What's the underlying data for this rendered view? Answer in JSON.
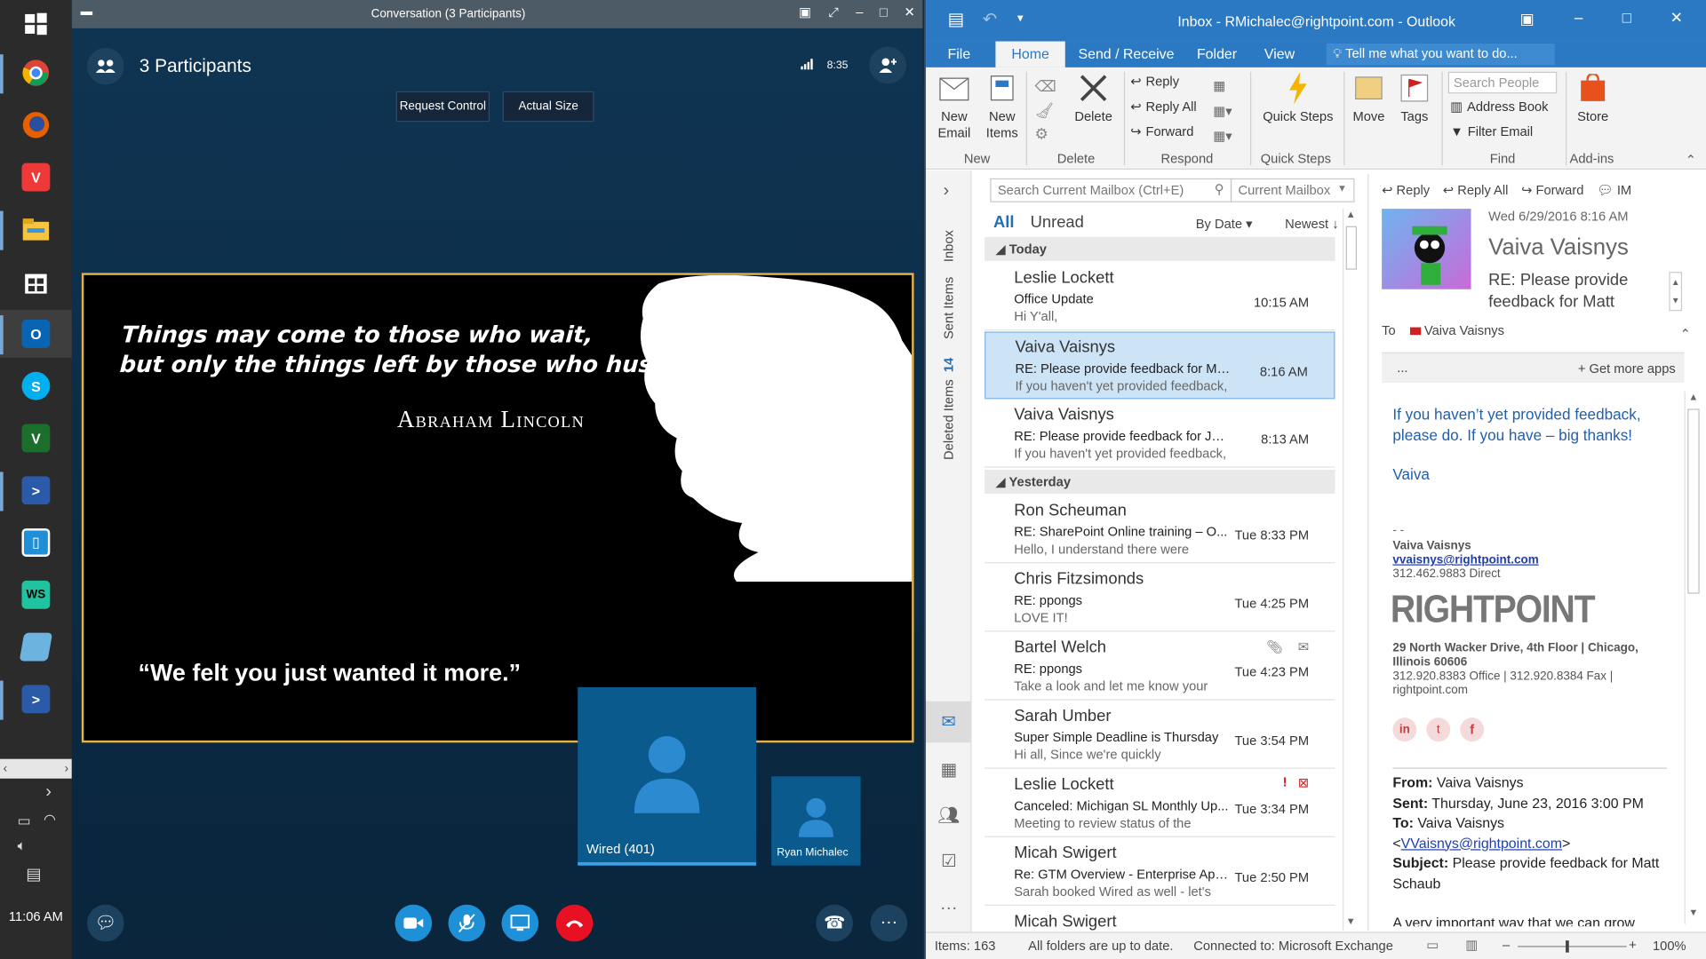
{
  "taskbar": {
    "icons": [
      "windows-logo-icon",
      "chrome-icon",
      "firefox-icon",
      "vivaldi-icon",
      "file-explorer-icon",
      "store-icon",
      "outlook-icon",
      "skype-icon",
      "vim-icon",
      "powershell-icon",
      "app-icon",
      "webstorm-icon",
      "notepad-icon",
      "powershell-icon"
    ],
    "clock": "11:06 AM"
  },
  "skype": {
    "window_title": "Conversation (3 Participants)",
    "participants_label": "3 Participants",
    "call_time": "8:35",
    "request_control": "Request Control",
    "actual_size": "Actual Size",
    "shared": {
      "quote": "Things may come to those who wait,",
      "quote_line2": "but only the things left by those who hustle.",
      "author": "Abraham Lincoln",
      "quote2": "“We felt you just wanted it more.”"
    },
    "tiles": [
      {
        "label": "Wired (401)"
      },
      {
        "label": "Ryan Michalec"
      }
    ]
  },
  "outlook": {
    "title": "Inbox - RMichalec@rightpoint.com - Outlook",
    "tabs": [
      "File",
      "Home",
      "Send / Receive",
      "Folder",
      "View"
    ],
    "tellme": "Tell me what you want to do...",
    "ribbon": {
      "new_email": "New Email",
      "new_items": "New Items",
      "delete": "Delete",
      "reply": "Reply",
      "reply_all": "Reply All",
      "forward": "Forward",
      "quick_steps": "Quick Steps",
      "move": "Move",
      "tags": "Tags",
      "search_people": "Search People",
      "address_book": "Address Book",
      "filter_email": "Filter Email",
      "store": "Store",
      "groups": [
        "New",
        "Delete",
        "Respond",
        "Quick Steps",
        "Find",
        "Add-ins"
      ]
    },
    "nav": {
      "inbox": "Inbox",
      "sent": "Sent Items",
      "deleted": "Deleted Items",
      "deleted_count": "14"
    },
    "list": {
      "search_placeholder": "Search Current Mailbox (Ctrl+E)",
      "scope": "Current Mailbox",
      "all": "All",
      "unread": "Unread",
      "by_date": "By Date",
      "newest": "Newest",
      "group_today": "Today",
      "group_yesterday": "Yesterday",
      "messages": [
        {
          "from": "Leslie Lockett",
          "subject": "Office Update",
          "preview": "Hi Y'all,",
          "time": "10:15 AM"
        },
        {
          "from": "Vaiva Vaisnys",
          "subject": "RE: Please provide feedback for Ma...",
          "preview": "If you haven't yet provided feedback,",
          "time": "8:16 AM"
        },
        {
          "from": "Vaiva Vaisnys",
          "subject": "RE: Please provide feedback for Jes...",
          "preview": "If you haven't yet provided feedback,",
          "time": "8:13 AM"
        },
        {
          "from": "Ron Scheuman",
          "subject": "RE: SharePoint Online training – O...",
          "preview": "Hello,  I understand there were",
          "time": "Tue 8:33 PM"
        },
        {
          "from": "Chris Fitzsimonds",
          "subject": "RE: ppongs",
          "preview": "LOVE IT!",
          "time": "Tue 4:25 PM"
        },
        {
          "from": "Bartel Welch",
          "subject": "RE: ppongs",
          "preview": "Take a look and let me know your",
          "time": "Tue 4:23 PM"
        },
        {
          "from": "Sarah Umber",
          "subject": "Super Simple Deadline is Thursday",
          "preview": "Hi all,  Since we're quickly",
          "time": "Tue 3:54 PM"
        },
        {
          "from": "Leslie Lockett",
          "subject": "Canceled: Michigan SL Monthly Up...",
          "preview": "Meeting to review status of the",
          "time": "Tue 3:34 PM"
        },
        {
          "from": "Micah Swigert",
          "subject": "Re: GTM Overview - Enterprise Appl...",
          "preview": "Sarah booked Wired as well - let's",
          "time": "Tue 2:50 PM"
        },
        {
          "from": "Micah Swigert",
          "subject": "",
          "preview": "",
          "time": ""
        }
      ]
    },
    "reading": {
      "reply": "Reply",
      "reply_all": "Reply All",
      "forward": "Forward",
      "im": "IM",
      "date": "Wed 6/29/2016 8:16 AM",
      "sender": "Vaiva Vaisnys",
      "subject": "RE: Please provide feedback for Matt",
      "to_label": "To",
      "to": "Vaiva Vaisnys",
      "more": "...",
      "get_more_apps": "Get more apps",
      "body1": "If you haven’t yet provided feedback, please do.  If you have – big thanks!",
      "body_sign": "Vaiva",
      "sig_dash": "- -",
      "sig_name": "Vaiva Vaisnys",
      "sig_email": "vvaisnys@rightpoint.com",
      "sig_direct": "312.462.9883 Direct",
      "logo": "RIGHTPOINT",
      "addr1": "29 North Wacker Drive, 4th Floor | Chicago, Illinois 60606",
      "addr2": "312.920.8383 Office | 312.920.8384 Fax | rightpoint.com",
      "from_lbl": "From:",
      "from_val": "Vaiva Vaisnys",
      "sent_lbl": "Sent:",
      "sent_val": "Thursday, June 23, 2016 3:00 PM",
      "tofw_lbl": "To:",
      "tofw_val": "Vaiva Vaisnys",
      "tofw_email": "VVaisnys@rightpoint.com",
      "subj_lbl": "Subject:",
      "subj_val": "Please provide feedback for Matt Schaub",
      "cut": "A very important way that we can grow"
    },
    "status": {
      "items": "Items: 163",
      "folders": "All folders are up to date.",
      "connected": "Connected to: Microsoft Exchange",
      "zoom": "100%"
    }
  }
}
